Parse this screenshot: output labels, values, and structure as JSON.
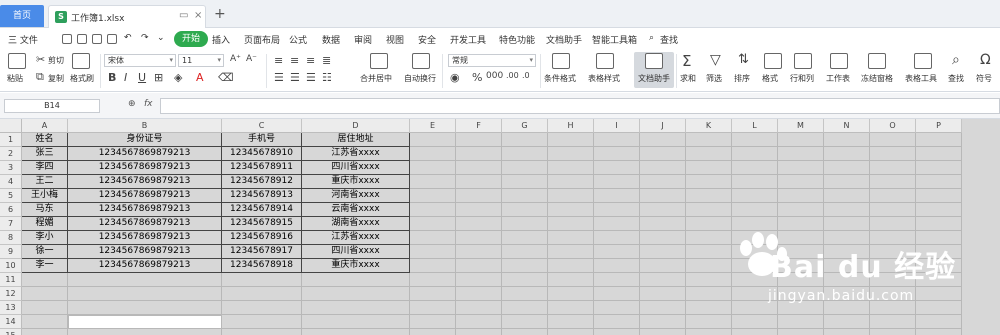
{
  "tabs": {
    "home": "首页",
    "file": "工作簿1.xlsx",
    "add": "+"
  },
  "menu": {
    "file": "三 文件",
    "active": "开始",
    "items": [
      "插入",
      "页面布局",
      "公式",
      "数据",
      "审阅",
      "视图",
      "安全",
      "开发工具",
      "特色功能",
      "文档助手",
      "智能工具箱",
      "查找"
    ]
  },
  "ribbon": {
    "paste": "粘贴",
    "cut": "剪切",
    "copy": "复制",
    "format_painter": "格式刷",
    "font_name": "宋体",
    "font_size": "11",
    "merge_center": "合并居中",
    "wrap_text": "自动换行",
    "number_format": "常规",
    "conditional_format": "条件格式",
    "table_style": "表格样式",
    "doc_helper": "文档助手",
    "sum": "求和",
    "filter": "筛选",
    "sort": "排序",
    "format": "格式",
    "row_col": "行和列",
    "worksheet": "工作表",
    "freeze": "冻结窗格",
    "table_tools": "表格工具",
    "find": "查找",
    "symbol": "符号"
  },
  "formula_bar": {
    "name_box": "B14",
    "fx": "fx",
    "value": ""
  },
  "columns": [
    "A",
    "B",
    "C",
    "D",
    "E",
    "F",
    "G",
    "H",
    "I",
    "J",
    "K",
    "L",
    "M",
    "N",
    "O",
    "P"
  ],
  "rows": [
    "1",
    "2",
    "3",
    "4",
    "5",
    "6",
    "7",
    "8",
    "9",
    "10",
    "11",
    "12",
    "13",
    "14",
    "15"
  ],
  "sheet": {
    "headers": [
      "姓名",
      "身份证号",
      "手机号",
      "居住地址"
    ],
    "data": [
      [
        "张三",
        "1234567869879213",
        "12345678910",
        "江苏省xxxx"
      ],
      [
        "李四",
        "1234567869879213",
        "12345678911",
        "四川省xxxx"
      ],
      [
        "王二",
        "1234567869879213",
        "12345678912",
        "重庆市xxxx"
      ],
      [
        "王小梅",
        "1234567869879213",
        "12345678913",
        "河南省xxxx"
      ],
      [
        "马东",
        "1234567869879213",
        "12345678914",
        "云南省xxxx"
      ],
      [
        "程媚",
        "1234567869879213",
        "12345678915",
        "湖南省xxxx"
      ],
      [
        "李小",
        "1234567869879213",
        "12345678916",
        "江苏省xxxx"
      ],
      [
        "徐一",
        "1234567869879213",
        "12345678917",
        "四川省xxxx"
      ],
      [
        "李一",
        "1234567869879213",
        "12345678918",
        "重庆市xxxx"
      ]
    ]
  },
  "watermark": {
    "brand": "Bai du 经验",
    "url": "jingyan.baidu.com"
  }
}
